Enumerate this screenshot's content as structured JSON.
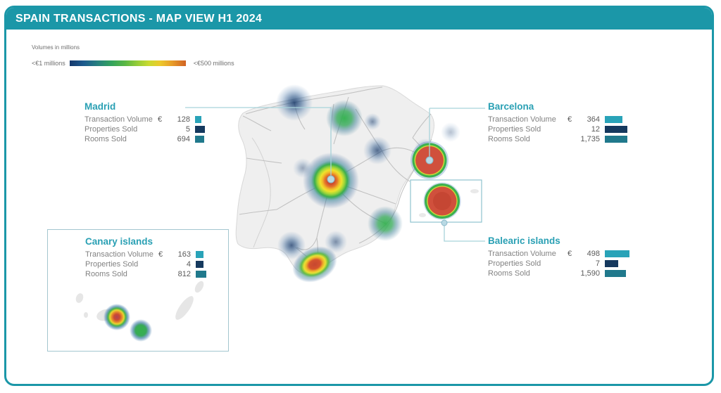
{
  "header": {
    "title": "SPAIN TRANSACTIONS - MAP VIEW H1 2024"
  },
  "legend": {
    "caption": "Volumes in millions",
    "min_label": "<€1 millions",
    "max_label": "<€500 millions"
  },
  "regions": {
    "madrid": {
      "name": "Madrid",
      "rows": [
        {
          "label": "Transaction Volume",
          "currency": "€",
          "value": "128",
          "value_num": 128,
          "metric": "tv"
        },
        {
          "label": "Properties Sold",
          "currency": "",
          "value": "5",
          "value_num": 5,
          "metric": "ps"
        },
        {
          "label": "Rooms Sold",
          "currency": "",
          "value": "694",
          "value_num": 694,
          "metric": "rs"
        }
      ]
    },
    "barcelona": {
      "name": "Barcelona",
      "rows": [
        {
          "label": "Transaction Volume",
          "currency": "€",
          "value": "364",
          "value_num": 364,
          "metric": "tv"
        },
        {
          "label": "Properties Sold",
          "currency": "",
          "value": "12",
          "value_num": 12,
          "metric": "ps"
        },
        {
          "label": "Rooms Sold",
          "currency": "",
          "value": "1,735",
          "value_num": 1735,
          "metric": "rs"
        }
      ]
    },
    "canary": {
      "name": "Canary islands",
      "rows": [
        {
          "label": "Transaction Volume",
          "currency": "€",
          "value": "163",
          "value_num": 163,
          "metric": "tv"
        },
        {
          "label": "Properties Sold",
          "currency": "",
          "value": "4",
          "value_num": 4,
          "metric": "ps"
        },
        {
          "label": "Rooms Sold",
          "currency": "",
          "value": "812",
          "value_num": 812,
          "metric": "rs"
        }
      ]
    },
    "balearic": {
      "name": "Balearic islands",
      "rows": [
        {
          "label": "Transaction Volume",
          "currency": "€",
          "value": "498",
          "value_num": 498,
          "metric": "tv"
        },
        {
          "label": "Properties Sold",
          "currency": "",
          "value": "7",
          "value_num": 7,
          "metric": "ps"
        },
        {
          "label": "Rooms Sold",
          "currency": "",
          "value": "1,590",
          "value_num": 1590,
          "metric": "rs"
        }
      ]
    }
  },
  "bars": {
    "scales": {
      "tv": 0.07,
      "ps": 2.7,
      "rs": 0.0187
    },
    "colors": {
      "tv": "#29a3b8",
      "ps": "#15395e",
      "rs": "#20798c"
    }
  },
  "colors": {
    "accent_teal": "#1b97a8",
    "region_title_teal": "#2aa0b4",
    "heat_red": "#d0503c",
    "heat_green": "#3cb14e",
    "leader_line": "#a8d3da"
  }
}
